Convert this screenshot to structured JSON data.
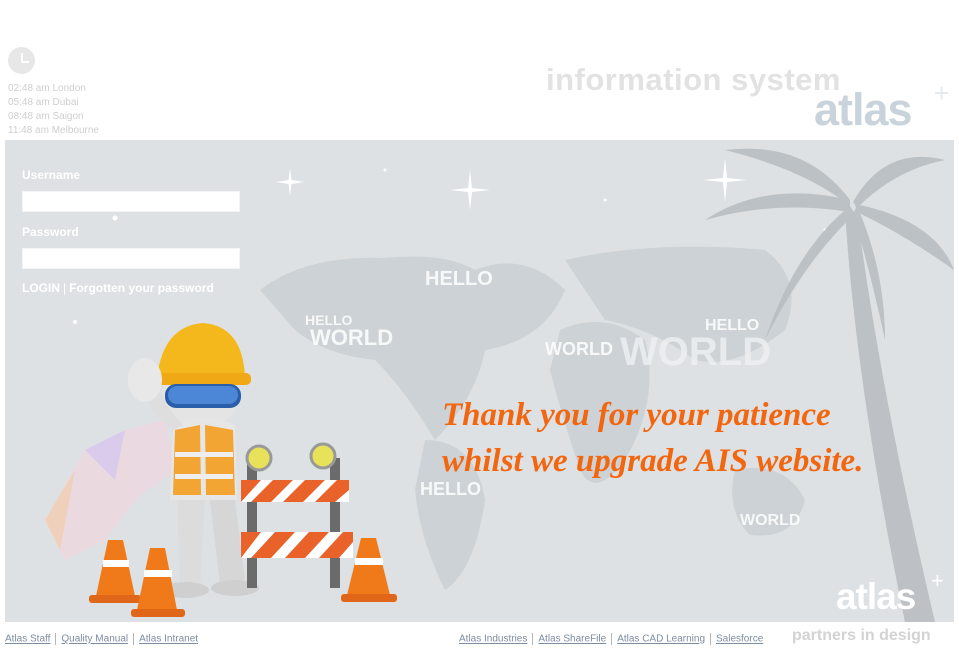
{
  "header": {
    "times": [
      "02:48 am London",
      "05:48 am Dubai",
      "08:48 am Saigon",
      "11:48 am Melbourne"
    ],
    "brand_system": "information system",
    "brand_name": "atlas",
    "clock_icon": "clock-icon"
  },
  "login": {
    "username_label": "Username",
    "username_value": "",
    "password_label": "Password",
    "password_value": "",
    "login_label": "LOGIN",
    "separator": "|",
    "forgot_label": "Forgotten your password"
  },
  "banner": {
    "message_line1": "Thank you for your patience",
    "message_line2": "whilst we upgrade AIS website.",
    "brand_name": "atlas",
    "map_words": [
      "HELLO",
      "WORLD",
      "HELLO",
      "WORLD",
      "HELLO",
      "WORLD",
      "HELLO",
      "WORLD"
    ],
    "colors": {
      "message": "#f2660f",
      "background": "#dde1e3",
      "helmet": "#f5b81c",
      "cone": "#f07a1a"
    }
  },
  "footer": {
    "left_links": [
      "Atlas Staff",
      "Quality Manual",
      "Atlas Intranet"
    ],
    "right_links": [
      "Atlas Industries",
      "Atlas ShareFile",
      "Atlas CAD Learning",
      "Salesforce"
    ],
    "tagline": "partners in design"
  }
}
